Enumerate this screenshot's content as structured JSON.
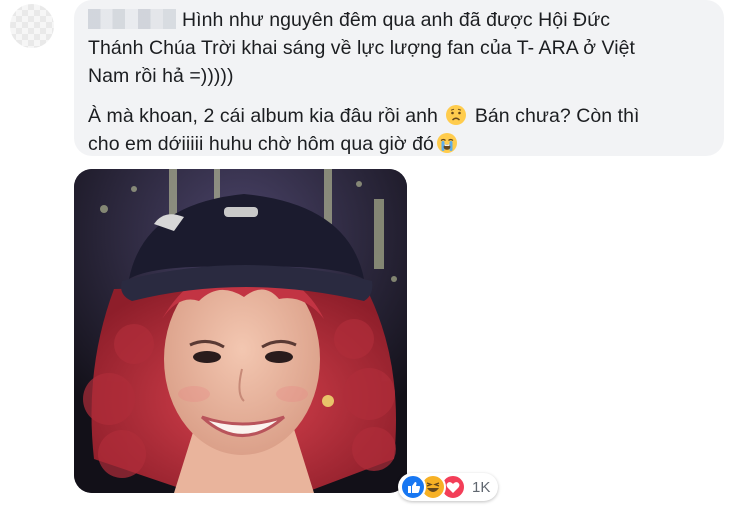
{
  "comment": {
    "line_1": "Hình như nguyên đêm qua anh đã được Hội Đức",
    "line_2": "Thánh Chúa Trời khai sáng về lực lượng fan của T- ARA ở Việt",
    "line_3": "Nam rồi hả =)))))",
    "para2_part1": "À mà khoan, 2 cái album kia đâu rồi anh",
    "para2_part2": "Bán chưa? Còn thì",
    "para2_part3": "cho em dớiiiii huhu chờ hôm qua giờ đó",
    "emoji_1": "worried-face-icon",
    "emoji_2": "crying-face-icon"
  },
  "photo": {
    "subject": "photo"
  },
  "reactions": {
    "types": [
      "like-icon",
      "haha-icon",
      "love-icon"
    ],
    "count": "1K",
    "colors": {
      "like": "#1877f2",
      "haha": "#f7b125",
      "love": "#f33e58"
    }
  },
  "theme": {
    "bubble_bg": "#f2f3f5",
    "text_color": "#1c1e21",
    "meta_color": "#606770"
  }
}
